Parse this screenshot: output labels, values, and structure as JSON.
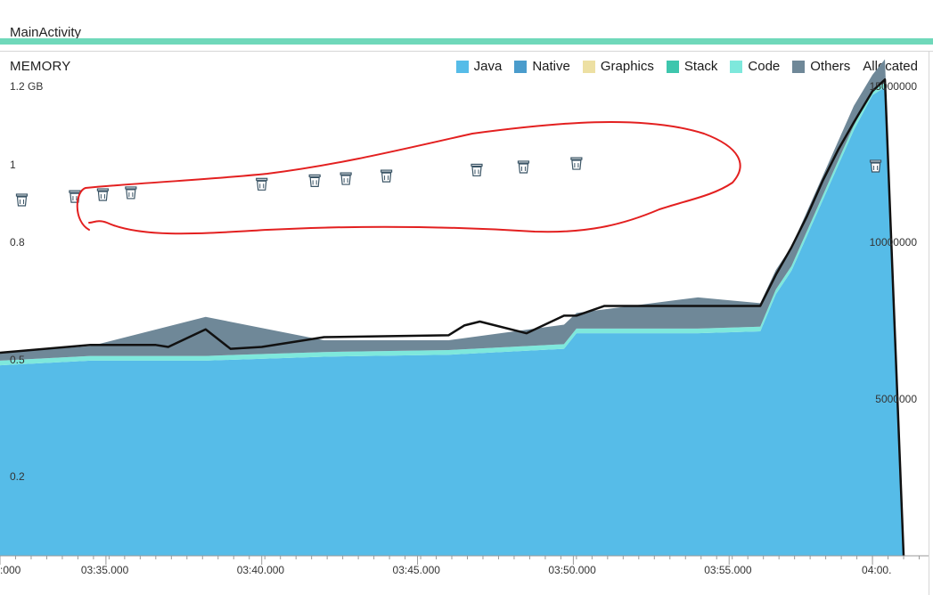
{
  "session": {
    "label": "MainActivity"
  },
  "chart_data": {
    "type": "area",
    "title": "MEMORY",
    "legend": [
      {
        "name": "Java",
        "color": "#56bce8"
      },
      {
        "name": "Native",
        "color": "#4a9ccc"
      },
      {
        "name": "Graphics",
        "color": "#ede0a3"
      },
      {
        "name": "Stack",
        "color": "#3ec6ad"
      },
      {
        "name": "Code",
        "color": "#7ee8dc"
      },
      {
        "name": "Others",
        "color": "#6f8898"
      },
      {
        "name": "Allocated",
        "color": "#111111"
      }
    ],
    "legend_position": "top-right",
    "y_left": {
      "ticks": [
        {
          "v": 0.2,
          "label": "0.2"
        },
        {
          "v": 0.5,
          "label": "0.5"
        },
        {
          "v": 0.8,
          "label": "0.8"
        },
        {
          "v": 1.0,
          "label": "1"
        },
        {
          "v": 1.2,
          "label": "1.2 GB"
        }
      ],
      "range": [
        0,
        1.2
      ],
      "unit": "GB"
    },
    "y_right": {
      "ticks": [
        {
          "v": 5000000,
          "label": "5000000"
        },
        {
          "v": 10000000,
          "label": "10000000"
        },
        {
          "v": 15000000,
          "label": "15000000"
        }
      ],
      "range": [
        0,
        15000000
      ]
    },
    "x_ticks": [
      {
        "t": 1.6,
        "label": ":000"
      },
      {
        "t": 5.0,
        "label": "03:35.000"
      },
      {
        "t": 10.0,
        "label": "03:40.000"
      },
      {
        "t": 15.0,
        "label": "03:45.000"
      },
      {
        "t": 20.0,
        "label": "03:50.000"
      },
      {
        "t": 25.0,
        "label": "03:55.000"
      },
      {
        "t": 29.6,
        "label": "04:00."
      }
    ],
    "x_range": [
      1.6,
      31.4
    ],
    "series": [
      {
        "name": "Java",
        "x": [
          1.6,
          4.5,
          8.2,
          12.0,
          16.0,
          19.7,
          20.1,
          24.0,
          26.0,
          26.5,
          27.0,
          27.5,
          28.0,
          28.5,
          29.0,
          29.6,
          30.0,
          30.6
        ],
        "values": [
          0.488,
          0.5,
          0.5,
          0.51,
          0.515,
          0.53,
          0.57,
          0.57,
          0.575,
          0.67,
          0.73,
          0.82,
          0.91,
          1.0,
          1.09,
          1.18,
          1.2,
          0.0
        ]
      },
      {
        "name": "Code",
        "x": [
          1.6,
          4.5,
          8.2,
          12.0,
          16.0,
          19.7,
          20.1,
          24.0,
          26.0,
          26.5,
          27.0,
          27.5,
          28.0,
          28.5,
          29.0,
          29.6,
          30.0,
          30.6
        ],
        "values": [
          0.012,
          0.012,
          0.012,
          0.012,
          0.012,
          0.012,
          0.012,
          0.012,
          0.012,
          0.012,
          0.012,
          0.012,
          0.012,
          0.012,
          0.012,
          0.012,
          0.012,
          0.0
        ]
      },
      {
        "name": "Others",
        "x": [
          1.6,
          4.5,
          8.2,
          12.0,
          16.0,
          19.7,
          20.1,
          24.0,
          26.0,
          26.5,
          27.0,
          27.5,
          28.0,
          28.5,
          29.0,
          29.6,
          30.0,
          30.6
        ],
        "values": [
          0.02,
          0.025,
          0.1,
          0.03,
          0.025,
          0.05,
          0.04,
          0.08,
          0.06,
          0.05,
          0.05,
          0.05,
          0.05,
          0.05,
          0.05,
          0.04,
          0.06,
          0.0
        ]
      }
    ],
    "allocated_line": {
      "x": [
        1.6,
        4.5,
        6.6,
        7.0,
        8.2,
        9.0,
        10.0,
        12.0,
        16.0,
        16.5,
        17.0,
        18.5,
        19.7,
        20.1,
        21.0,
        24.0,
        26.0,
        26.5,
        27.0,
        27.5,
        28.0,
        28.5,
        29.0,
        29.6,
        30.0,
        30.6
      ],
      "values": [
        0.52,
        0.54,
        0.54,
        0.535,
        0.58,
        0.53,
        0.535,
        0.56,
        0.565,
        0.59,
        0.6,
        0.57,
        0.615,
        0.615,
        0.64,
        0.64,
        0.64,
        0.72,
        0.79,
        0.87,
        0.96,
        1.04,
        1.11,
        1.19,
        1.22,
        0.0
      ]
    },
    "gc_events": [
      2.3,
      4.0,
      4.9,
      5.8,
      10.0,
      11.7,
      12.7,
      14.0,
      16.9,
      18.4,
      20.1,
      29.7
    ]
  }
}
